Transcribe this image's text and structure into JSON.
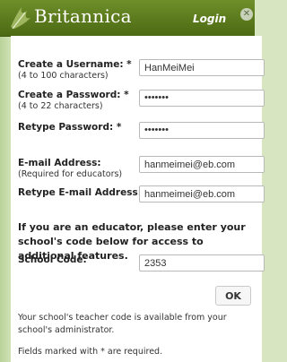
{
  "header": {
    "brand": "Britannica",
    "title": "Login",
    "close_icon": "close-icon",
    "logo_icon": "thistle-logo-icon"
  },
  "form": {
    "username": {
      "label": "Create a Username: *",
      "hint": "(4 to 100 characters)",
      "value": "HanMeiMei"
    },
    "password": {
      "label": "Create a Password: *",
      "hint": "(4 to 22 characters)",
      "value": "•••••••"
    },
    "retype_password": {
      "label": "Retype Password: *",
      "value": "•••••••"
    },
    "email": {
      "label": "E-mail Address:",
      "hint": "(Required for educators)",
      "value": "hanmeimei@eb.com"
    },
    "retype_email": {
      "label": "Retype E-mail Address:",
      "value": "hanmeimei@eb.com"
    },
    "educator_note": "If you are an educator, please enter your school's code below for access to additional features.",
    "school_code": {
      "label": "School Code:",
      "value": "2353"
    },
    "ok_label": "OK"
  },
  "footer": {
    "teacher_code_note": "Your school's teacher code is available from your school's administrator.",
    "required_note": "Fields marked with * are required."
  },
  "colors": {
    "header_green": "#5b7a1d",
    "side_green": "#d7e6c0"
  }
}
